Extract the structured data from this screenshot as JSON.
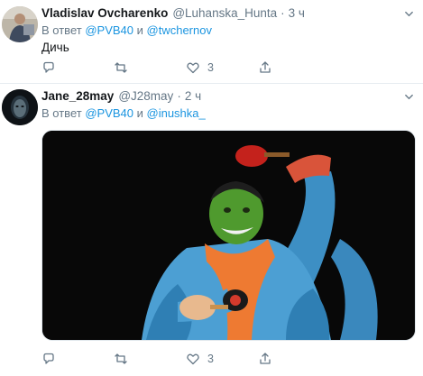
{
  "tweets": [
    {
      "name": "Vladislav Ovcharenko",
      "handle": "@Luhanska_Hunta",
      "separator": "·",
      "time": "3 ч",
      "reply_prefix": "В ответ",
      "reply_user1": "@PVB40",
      "reply_and": "и",
      "reply_user2": "@twchernov",
      "text": "Дичь",
      "likes": "3"
    },
    {
      "name": "Jane_28may",
      "handle": "@J28may",
      "separator": "·",
      "time": "2 ч",
      "reply_prefix": "В ответ",
      "reply_user1": "@PVB40",
      "reply_and": "и",
      "reply_user2": "@inushka_",
      "likes": "3"
    }
  ],
  "icons": [
    "reply-icon",
    "retweet-icon",
    "like-icon",
    "share-icon",
    "caret-down-icon"
  ],
  "colors": {
    "link": "#1b95e0",
    "muted": "#657786",
    "text": "#14171a",
    "divider": "#e6ecf0"
  }
}
